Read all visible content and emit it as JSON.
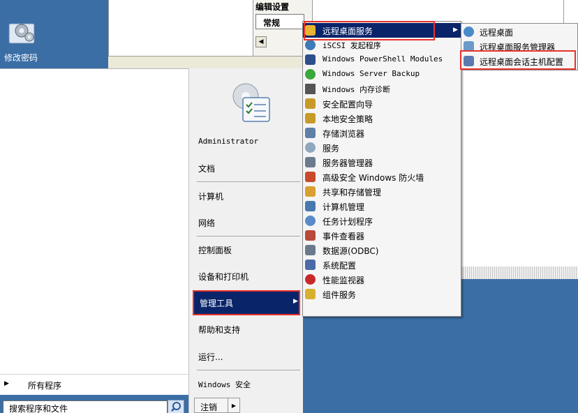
{
  "desktop": {
    "shortcut_label": "修改密码",
    "edit_settings": "编辑设置",
    "general_tab": "常规",
    "scroll_left": "◀"
  },
  "start_menu": {
    "all_programs_arrow": "▶",
    "all_programs": "所有程序",
    "search_placeholder": "搜索程序和文件",
    "right_items": [
      {
        "label": "Administrator"
      },
      {
        "label": "文档"
      },
      {
        "label": "计算机"
      },
      {
        "label": "网络"
      },
      {
        "label": "控制面板"
      },
      {
        "label": "设备和打印机"
      },
      {
        "label": "管理工具"
      },
      {
        "label": "帮助和支持"
      },
      {
        "label": "运行..."
      },
      {
        "label": "Windows 安全"
      }
    ],
    "admin_tools_arrow": "▶",
    "logoff": "注销",
    "logoff_arrow": "▶"
  },
  "admin_tools": {
    "items": [
      {
        "label": "远程桌面服务",
        "icon": "folder-icon",
        "color": "#e8b530"
      },
      {
        "label": "iSCSI 发起程序",
        "icon": "iscsi-icon",
        "color": "#3d7ab8"
      },
      {
        "label": "Windows PowerShell Modules",
        "icon": "powershell-icon",
        "color": "#2c4f8c"
      },
      {
        "label": "Windows Server Backup",
        "icon": "backup-icon",
        "color": "#3aa83a"
      },
      {
        "label": "Windows 内存诊断",
        "icon": "memory-icon",
        "color": "#555555"
      },
      {
        "label": "安全配置向导",
        "icon": "wizard-icon",
        "color": "#c89a2a"
      },
      {
        "label": "本地安全策略",
        "icon": "policy-icon",
        "color": "#c89a2a"
      },
      {
        "label": "存储浏览器",
        "icon": "storage-icon",
        "color": "#5f7fa8"
      },
      {
        "label": "服务",
        "icon": "services-icon",
        "color": "#8fa8c0"
      },
      {
        "label": "服务器管理器",
        "icon": "server-manager-icon",
        "color": "#6a7b8c"
      },
      {
        "label": "高级安全 Windows 防火墙",
        "icon": "firewall-icon",
        "color": "#c84a2a"
      },
      {
        "label": "共享和存储管理",
        "icon": "share-icon",
        "color": "#d8a030"
      },
      {
        "label": "计算机管理",
        "icon": "computer-management-icon",
        "color": "#4a78b0"
      },
      {
        "label": "任务计划程序",
        "icon": "scheduler-icon",
        "color": "#5a8ac8"
      },
      {
        "label": "事件查看器",
        "icon": "event-viewer-icon",
        "color": "#b84a3a"
      },
      {
        "label": "数据源(ODBC)",
        "icon": "odbc-icon",
        "color": "#6a7a8a"
      },
      {
        "label": "系统配置",
        "icon": "sysconfig-icon",
        "color": "#4a6aa8"
      },
      {
        "label": "性能监视器",
        "icon": "perf-monitor-icon",
        "color": "#c82a2a"
      },
      {
        "label": "组件服务",
        "icon": "component-icon",
        "color": "#d8b030"
      }
    ],
    "rds_arrow": "▶"
  },
  "rds_menu": {
    "items": [
      {
        "label": "远程桌面",
        "icon": "remote-desktop-icon",
        "color": "#4a8ac8"
      },
      {
        "label": "远程桌面服务管理器",
        "icon": "rds-manager-icon",
        "color": "#6a9ac8"
      },
      {
        "label": "远程桌面会话主机配置",
        "icon": "rdsh-config-icon",
        "color": "#5a7ab0"
      }
    ]
  },
  "colors": {
    "desktop_blue": "#3a6ea5",
    "menu_highlight": "#0a246a",
    "annotation_red": "#e8312a"
  }
}
